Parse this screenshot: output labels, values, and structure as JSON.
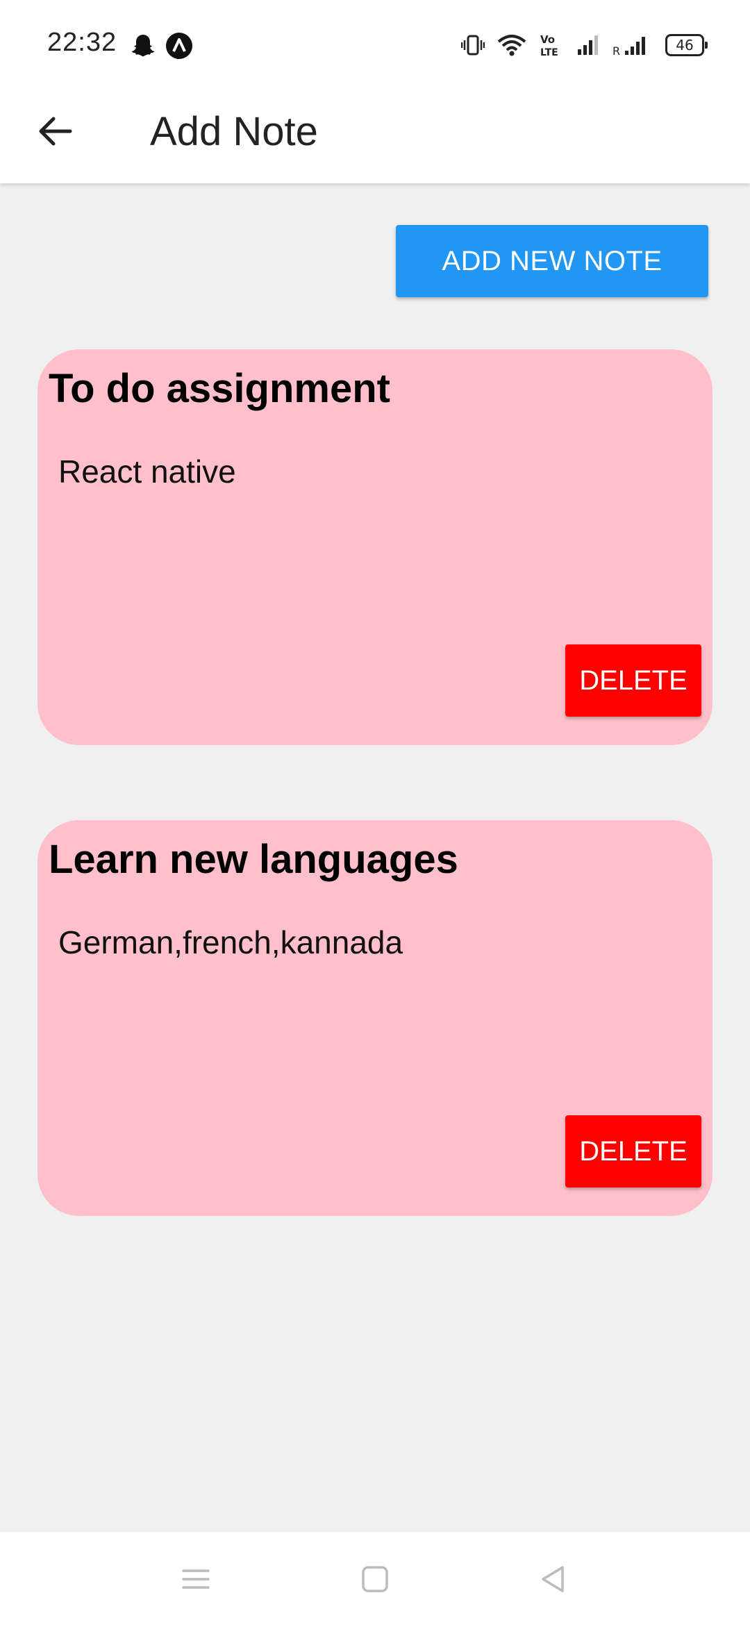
{
  "status_bar": {
    "time": "22:32",
    "battery_level": "46",
    "icons": [
      "snapchat-icon",
      "app-notification-icon",
      "vibrate-icon",
      "wifi-icon",
      "volte-icon",
      "signal-icon",
      "roaming-signal-icon",
      "battery-icon"
    ]
  },
  "app_bar": {
    "title": "Add Note",
    "back_icon": "arrow-left-icon"
  },
  "actions": {
    "add_label": "ADD NEW NOTE"
  },
  "notes": [
    {
      "title": "To do assignment",
      "body": "React native",
      "delete_label": "DELETE"
    },
    {
      "title": "Learn new languages",
      "body": "German,french,kannada",
      "delete_label": "DELETE"
    }
  ],
  "nav_bar": {
    "icons": [
      "menu-icon",
      "home-icon",
      "back-icon"
    ]
  },
  "colors": {
    "primary": "#2196f3",
    "card": "#ffc0cb",
    "danger": "#ff0000",
    "background": "#f0f0f0"
  }
}
